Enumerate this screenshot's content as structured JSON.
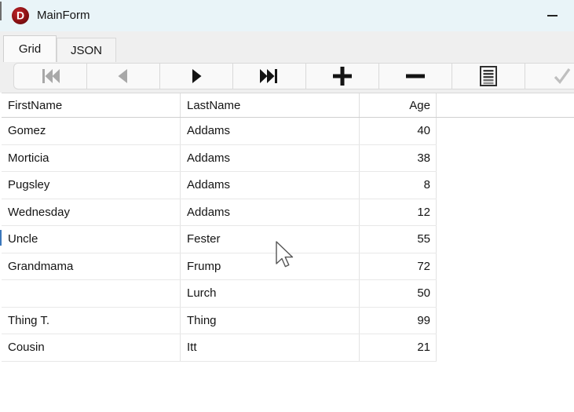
{
  "window": {
    "title": "MainForm",
    "app_icon_letter": "D",
    "controls": [
      {
        "name": "minimize",
        "icon": "minimize-icon"
      }
    ]
  },
  "tabs": {
    "items": [
      {
        "label": "Grid",
        "active": true
      },
      {
        "label": "JSON",
        "active": false
      }
    ]
  },
  "toolbar": {
    "buttons": [
      {
        "name": "first-record",
        "icon": "first-record-icon",
        "enabled": false
      },
      {
        "name": "prior-record",
        "icon": "prior-record-icon",
        "enabled": false
      },
      {
        "name": "next-record",
        "icon": "next-record-icon",
        "enabled": true
      },
      {
        "name": "last-record",
        "icon": "last-record-icon",
        "enabled": true
      },
      {
        "name": "insert-record",
        "icon": "plus-icon",
        "enabled": true
      },
      {
        "name": "delete-record",
        "icon": "minus-icon",
        "enabled": true
      },
      {
        "name": "edit-record",
        "icon": "edit-record-icon",
        "enabled": true
      },
      {
        "name": "post-edit",
        "icon": "check-icon",
        "enabled": false
      }
    ]
  },
  "grid": {
    "columns": [
      {
        "label": "FirstName",
        "align": "left"
      },
      {
        "label": "LastName",
        "align": "left"
      },
      {
        "label": "Age",
        "align": "right"
      }
    ],
    "rows": [
      [
        "Gomez",
        "Addams",
        "40"
      ],
      [
        "Morticia",
        "Addams",
        "38"
      ],
      [
        "Pugsley",
        "Addams",
        "8"
      ],
      [
        "Wednesday",
        "Addams",
        "12"
      ],
      [
        "Uncle",
        "Fester",
        "55"
      ],
      [
        "Grandmama",
        "Frump",
        "72"
      ],
      [
        "",
        "Lurch",
        "50"
      ],
      [
        "Thing T.",
        "Thing",
        "99"
      ],
      [
        "Cousin",
        "Itt",
        "21"
      ]
    ]
  },
  "colors": {
    "titlebar_bg": "#e9f4f8",
    "tabstrip_bg": "#efefef",
    "app_icon_red": "#8a1013",
    "selection_tick_blue": "#3b77bb",
    "grid_line": "#e8e8e8",
    "disabled_icon": "#a8a8a8"
  }
}
